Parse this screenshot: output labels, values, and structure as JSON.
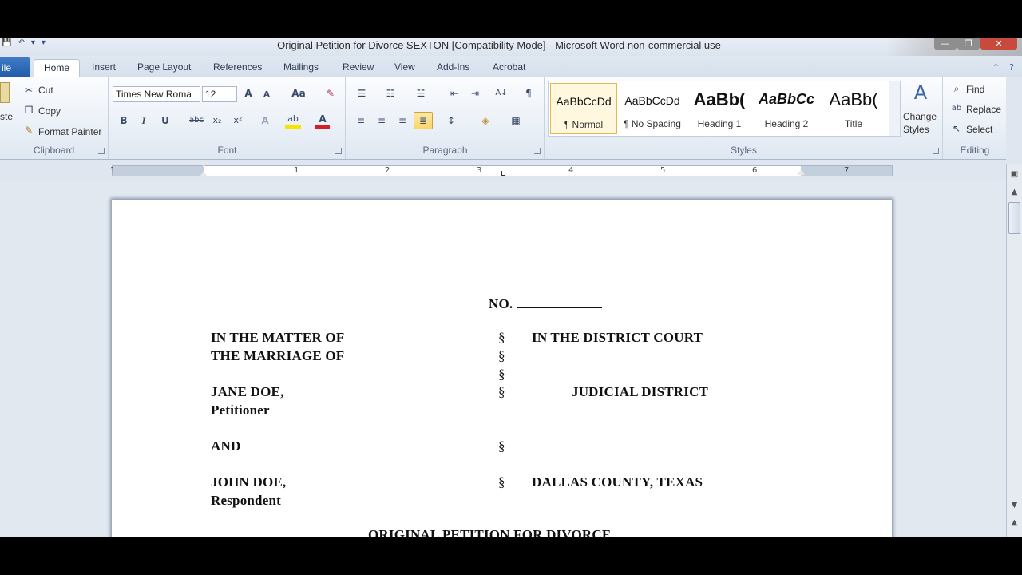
{
  "window": {
    "title": "Original Petition for Divorce SEXTON [Compatibility Mode]  -  Microsoft Word non-commercial use",
    "minimize": "—",
    "maximize": "❐",
    "close": "✕"
  },
  "qat": {
    "save": "💾",
    "undo": "↶",
    "redo": "▾",
    "more": "▾"
  },
  "tabs": [
    "ile",
    "Home",
    "Insert",
    "Page Layout",
    "References",
    "Mailings",
    "Review",
    "View",
    "Add-Ins",
    "Acrobat"
  ],
  "tabs_right": {
    "collapse": "⌃",
    "help": "?"
  },
  "clipboard": {
    "paste": "ste",
    "cut": "Cut",
    "copy": "Copy",
    "format_painter": "Format Painter",
    "label": "Clipboard"
  },
  "font": {
    "name": "Times New Roma",
    "size": "12",
    "grow": "A",
    "shrink": "A",
    "change_case": "Aa",
    "clear": "✎",
    "bold": "B",
    "italic": "I",
    "underline": "U",
    "strike": "abc",
    "sub": "x₂",
    "sup": "x²",
    "effects": "A",
    "highlight": "ab",
    "color": "A",
    "label": "Font"
  },
  "paragraph": {
    "label": "Paragraph",
    "pilcrow": "¶",
    "sort": "A↓"
  },
  "styles": {
    "label": "Styles",
    "items": [
      {
        "preview": "AaBbCcDd",
        "name": "¶ Normal"
      },
      {
        "preview": "AaBbCcDd",
        "name": "¶ No Spacing"
      },
      {
        "preview": "AaBb(",
        "name": "Heading 1"
      },
      {
        "preview": "AaBbCc",
        "name": "Heading 2"
      },
      {
        "preview": "AaBb(",
        "name": "Title"
      }
    ],
    "change_styles_1": "Change",
    "change_styles_2": "Styles"
  },
  "editing": {
    "find": "Find",
    "replace": "Replace",
    "select": "Select",
    "label": "Editing"
  },
  "ruler": {
    "numbers": [
      "1",
      "1",
      "2",
      "3",
      "4",
      "5",
      "6",
      "7"
    ]
  },
  "document": {
    "no": "NO.",
    "left": [
      "IN THE MATTER OF",
      "THE MARRIAGE  OF",
      "JANE DOE,",
      "Petitioner",
      "AND",
      "JOHN DOE,",
      "Respondent"
    ],
    "section": "§",
    "right": [
      "IN THE DISTRICT  COURT",
      "JUDICIAL  DISTRICT",
      "DALLAS  COUNTY,  TEXAS"
    ],
    "heading": "ORIGINAL PETITION FOR DIVORCE"
  }
}
